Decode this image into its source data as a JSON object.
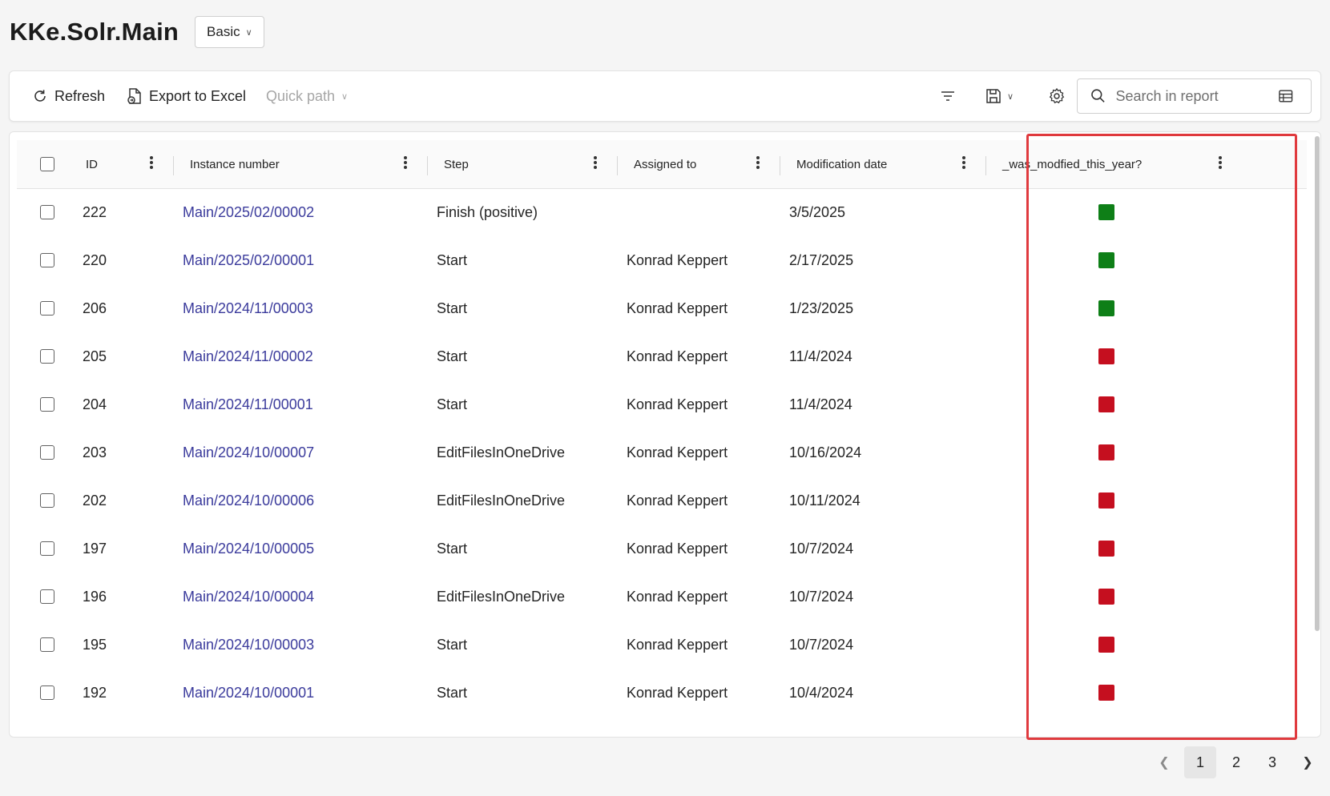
{
  "header": {
    "title": "KKe.Solr.Main",
    "view_selector": "Basic"
  },
  "toolbar": {
    "refresh_label": "Refresh",
    "export_label": "Export to Excel",
    "quick_path_label": "Quick path",
    "search_placeholder": "Search in report"
  },
  "columns": {
    "id": "ID",
    "instance": "Instance number",
    "step": "Step",
    "assigned": "Assigned to",
    "modified": "Modification date",
    "flag": "_was_modfied_this_year?"
  },
  "rows": [
    {
      "id": "222",
      "instance": "Main/2025/02/00002",
      "step": "Finish (positive)",
      "assigned": "",
      "modified": "3/5/2025",
      "flag": "positive"
    },
    {
      "id": "220",
      "instance": "Main/2025/02/00001",
      "step": "Start",
      "assigned": "Konrad Keppert",
      "modified": "2/17/2025",
      "flag": "positive"
    },
    {
      "id": "206",
      "instance": "Main/2024/11/00003",
      "step": "Start",
      "assigned": "Konrad Keppert",
      "modified": "1/23/2025",
      "flag": "positive"
    },
    {
      "id": "205",
      "instance": "Main/2024/11/00002",
      "step": "Start",
      "assigned": "Konrad Keppert",
      "modified": "11/4/2024",
      "flag": "negative"
    },
    {
      "id": "204",
      "instance": "Main/2024/11/00001",
      "step": "Start",
      "assigned": "Konrad Keppert",
      "modified": "11/4/2024",
      "flag": "negative"
    },
    {
      "id": "203",
      "instance": "Main/2024/10/00007",
      "step": "EditFilesInOneDrive",
      "assigned": "Konrad Keppert",
      "modified": "10/16/2024",
      "flag": "negative"
    },
    {
      "id": "202",
      "instance": "Main/2024/10/00006",
      "step": "EditFilesInOneDrive",
      "assigned": "Konrad Keppert",
      "modified": "10/11/2024",
      "flag": "negative"
    },
    {
      "id": "197",
      "instance": "Main/2024/10/00005",
      "step": "Start",
      "assigned": "Konrad Keppert",
      "modified": "10/7/2024",
      "flag": "negative"
    },
    {
      "id": "196",
      "instance": "Main/2024/10/00004",
      "step": "EditFilesInOneDrive",
      "assigned": "Konrad Keppert",
      "modified": "10/7/2024",
      "flag": "negative"
    },
    {
      "id": "195",
      "instance": "Main/2024/10/00003",
      "step": "Start",
      "assigned": "Konrad Keppert",
      "modified": "10/7/2024",
      "flag": "negative"
    },
    {
      "id": "192",
      "instance": "Main/2024/10/00001",
      "step": "Start",
      "assigned": "Konrad Keppert",
      "modified": "10/4/2024",
      "flag": "negative"
    }
  ],
  "pagination": {
    "pages": [
      "1",
      "2",
      "3"
    ],
    "current": "1"
  },
  "colors": {
    "positive": "#0e7f17",
    "negative": "#c50f1f",
    "highlight": "#e03a3e"
  }
}
